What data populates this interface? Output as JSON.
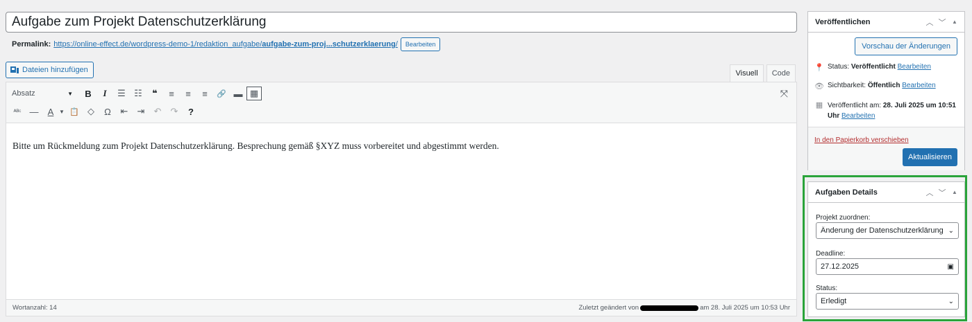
{
  "title": "Aufgabe zum Projekt Datenschutzerklärung",
  "permalink": {
    "label": "Permalink:",
    "base": "https://online-effect.de/wordpress-demo-1/redaktion_aufgabe/",
    "slug": "aufgabe-zum-proj...schutzerklaerung",
    "trailing": "/",
    "edit_label": "Bearbeiten"
  },
  "add_media_label": "Dateien hinzufügen",
  "mode_tabs": {
    "visual": "Visuell",
    "code": "Code"
  },
  "toolbar": {
    "format_value": "Absatz",
    "row1": [
      "B",
      "I",
      "☰",
      "☷",
      "❝",
      "≡",
      "≡",
      "≡",
      "🔗",
      "▬",
      "▦"
    ],
    "row2": [
      "ᴬᴮᶜ",
      "—",
      "A",
      "📋",
      "◇",
      "Ω",
      "⇤",
      "⇥",
      "↶",
      "↷",
      "?"
    ]
  },
  "content_text": "Bitte um Rückmeldung zum Projekt Datenschutzerklärung. Besprechung gemäß §XYZ muss vorbereitet und abgestimmt werden.",
  "statusbar": {
    "word_count": "Wortanzahl: 14",
    "last_changed_prefix": "Zuletzt geändert von",
    "last_changed_suffix": "am 28. Juli 2025 um 10:53 Uhr"
  },
  "publish": {
    "title": "Veröffentlichen",
    "preview_label": "Vorschau der Änderungen",
    "status_label": "Status:",
    "status_value": "Veröffentlicht",
    "visibility_label": "Sichtbarkeit:",
    "visibility_value": "Öffentlich",
    "published_label": "Veröffentlicht am:",
    "published_value": "28. Juli 2025 um 10:51 Uhr",
    "edit_label": "Bearbeiten",
    "trash_label": "In den Papierkorb verschieben",
    "update_label": "Aktualisieren"
  },
  "details": {
    "title": "Aufgaben Details",
    "project_label": "Projekt zuordnen:",
    "project_value": "Änderung der Datenschutzerklärung",
    "deadline_label": "Deadline:",
    "deadline_value": "27.12.2025",
    "status_label": "Status:",
    "status_value": "Erledigt"
  },
  "colors": {
    "accent": "#2271b1",
    "highlight": "#2aa33a",
    "danger": "#b32d2e"
  }
}
